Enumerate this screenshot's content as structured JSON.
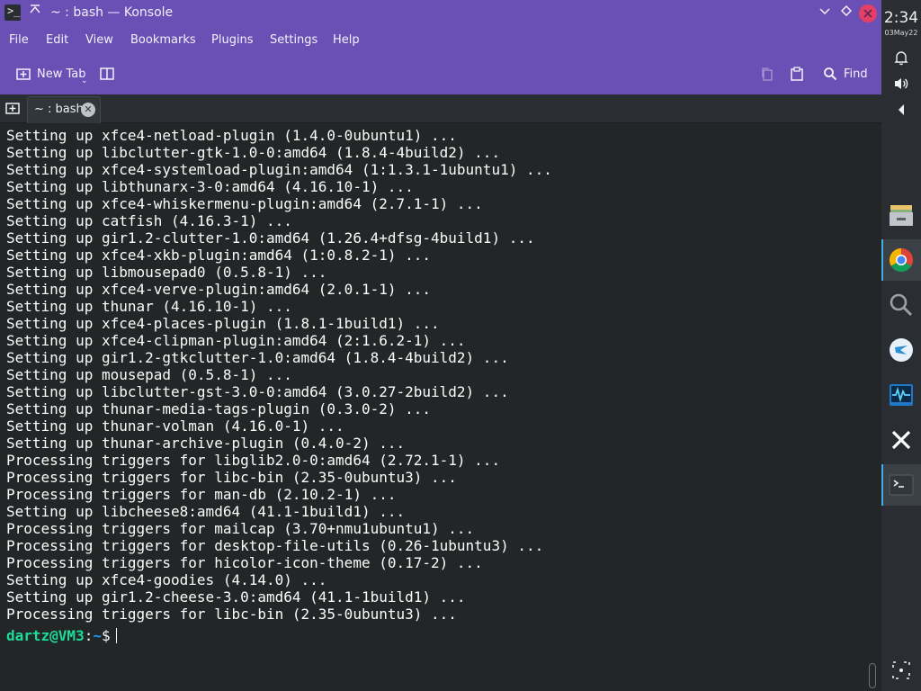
{
  "window": {
    "title": "~ : bash — Konsole",
    "app_icon": ">_",
    "buttons": [
      "minimize-icon",
      "maximize-icon",
      "close-icon"
    ]
  },
  "menu": [
    "File",
    "Edit",
    "View",
    "Bookmarks",
    "Plugins",
    "Settings",
    "Help"
  ],
  "toolbar": {
    "new_tab_label": "New Tab",
    "find_label": "Find"
  },
  "tab": {
    "label": "~ : bash"
  },
  "terminal": {
    "lines": [
      "Setting up xfce4-netload-plugin (1.4.0-0ubuntu1) ...",
      "Setting up libclutter-gtk-1.0-0:amd64 (1.8.4-4build2) ...",
      "Setting up xfce4-systemload-plugin:amd64 (1:1.3.1-1ubuntu1) ...",
      "Setting up libthunarx-3-0:amd64 (4.16.10-1) ...",
      "Setting up xfce4-whiskermenu-plugin:amd64 (2.7.1-1) ...",
      "Setting up catfish (4.16.3-1) ...",
      "Setting up gir1.2-clutter-1.0:amd64 (1.26.4+dfsg-4build1) ...",
      "Setting up xfce4-xkb-plugin:amd64 (1:0.8.2-1) ...",
      "Setting up libmousepad0 (0.5.8-1) ...",
      "Setting up xfce4-verve-plugin:amd64 (2.0.1-1) ...",
      "Setting up thunar (4.16.10-1) ...",
      "Setting up xfce4-places-plugin (1.8.1-1build1) ...",
      "Setting up xfce4-clipman-plugin:amd64 (2:1.6.2-1) ...",
      "Setting up gir1.2-gtkclutter-1.0:amd64 (1.8.4-4build2) ...",
      "Setting up mousepad (0.5.8-1) ...",
      "Setting up libclutter-gst-3.0-0:amd64 (3.0.27-2build2) ...",
      "Setting up thunar-media-tags-plugin (0.3.0-2) ...",
      "Setting up thunar-volman (4.16.0-1) ...",
      "Setting up thunar-archive-plugin (0.4.0-2) ...",
      "Processing triggers for libglib2.0-0:amd64 (2.72.1-1) ...",
      "Processing triggers for libc-bin (2.35-0ubuntu3) ...",
      "Processing triggers for man-db (2.10.2-1) ...",
      "Setting up libcheese8:amd64 (41.1-1build1) ...",
      "Processing triggers for mailcap (3.70+nmu1ubuntu1) ...",
      "Processing triggers for desktop-file-utils (0.26-1ubuntu3) ...",
      "Processing triggers for hicolor-icon-theme (0.17-2) ...",
      "Setting up xfce4-goodies (4.14.0) ...",
      "Setting up gir1.2-cheese-3.0:amd64 (41.1-1build1) ...",
      "Processing triggers for libc-bin (2.35-0ubuntu3) ..."
    ],
    "prompt": {
      "user_host": "dartz@VM3",
      "separator": ":",
      "path": "~",
      "symbol": "$"
    }
  },
  "panel": {
    "time": "2:34",
    "date": "03May22",
    "tray_icons": [
      "bell-icon",
      "volume-icon",
      "expand-arrow-icon"
    ],
    "tasks": [
      "files-icon",
      "chrome-icon",
      "search-icon",
      "app-icon",
      "system-monitor-icon",
      "xwindow-icon",
      "konsole-icon"
    ]
  },
  "colors": {
    "titlebar": "#6a4fb4",
    "terminal_bg": "#232627",
    "prompt_user": "#1cdc9a",
    "prompt_path": "#1d99f3",
    "close_button": "#e43f64",
    "panel_bg": "#2a2d32"
  }
}
